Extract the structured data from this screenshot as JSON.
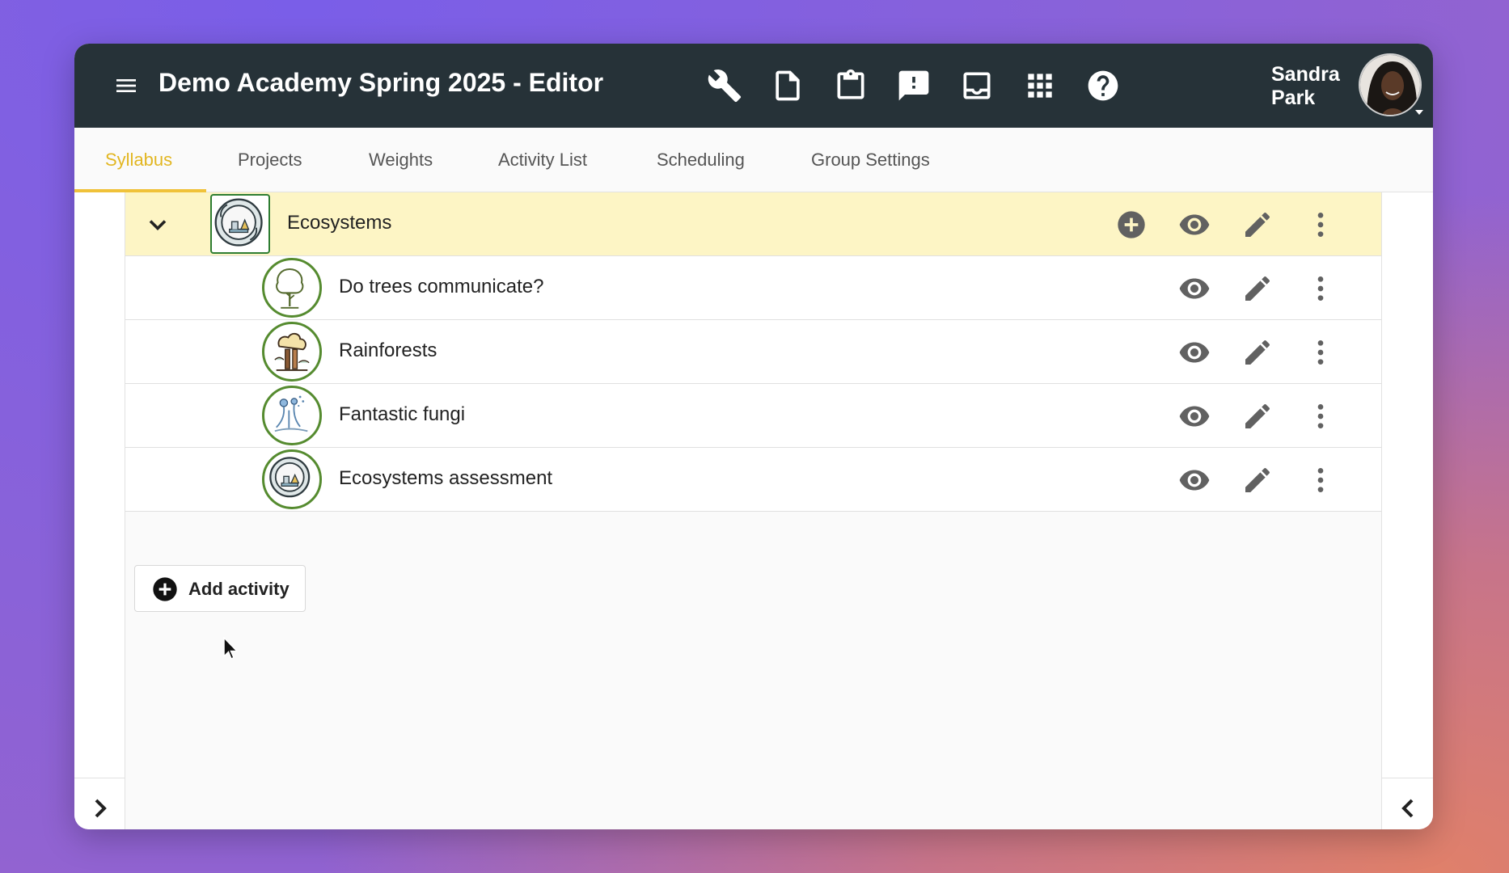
{
  "header": {
    "title": "Demo Academy Spring 2025 - Editor",
    "user_name": "Sandra Park",
    "icons": [
      "menu-icon",
      "wrench-icon",
      "page-search-icon",
      "clipboard-icon",
      "feedback-icon",
      "inbox-icon",
      "apps-grid-icon",
      "help-icon"
    ]
  },
  "tabs": [
    {
      "label": "Syllabus",
      "active": true
    },
    {
      "label": "Projects",
      "active": false
    },
    {
      "label": "Weights",
      "active": false
    },
    {
      "label": "Activity List",
      "active": false
    },
    {
      "label": "Scheduling",
      "active": false
    },
    {
      "label": "Group Settings",
      "active": false
    }
  ],
  "unit": {
    "title": "Ecosystems",
    "icon": "ecosystem-icon"
  },
  "activities": [
    {
      "title": "Do trees communicate?",
      "icon": "tree-icon"
    },
    {
      "title": "Rainforests",
      "icon": "rainforest-icon"
    },
    {
      "title": "Fantastic fungi",
      "icon": "fungi-icon"
    },
    {
      "title": "Ecosystems assessment",
      "icon": "ecosystem-icon"
    }
  ],
  "add_activity_label": "Add activity",
  "colors": {
    "topbar": "#263238",
    "active_tab": "#e2b621",
    "unit_row": "#fdf5c5",
    "icon_gray": "#616161"
  }
}
